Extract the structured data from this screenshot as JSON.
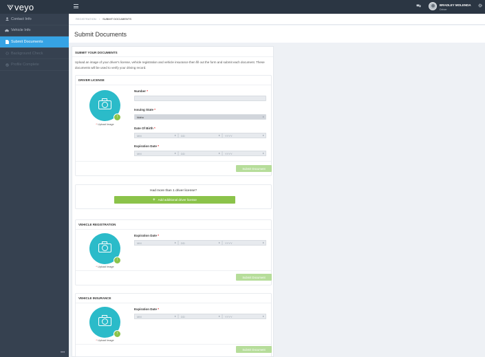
{
  "app": {
    "logo": "veyo"
  },
  "sidebar": {
    "items": [
      {
        "label": "Contact Info",
        "icon": "user-icon",
        "state": "normal"
      },
      {
        "label": "Vehicle Info",
        "icon": "car-icon",
        "state": "normal"
      },
      {
        "label": "Submit Documents",
        "icon": "document-icon",
        "state": "active"
      },
      {
        "label": "Background Check",
        "icon": "gear-icon",
        "state": "disabled"
      },
      {
        "label": "Profile Complete",
        "icon": "check-icon",
        "state": "disabled"
      }
    ]
  },
  "topbar": {
    "user_name": "BRADLEY MOLENDA",
    "user_role": "Driver"
  },
  "breadcrumb": {
    "root": "REGISTRATION",
    "current": "SUBMIT DOCUMENTS"
  },
  "page_title": "Submit Documents",
  "panel": {
    "heading": "SUBMIT YOUR DOCUMENTS",
    "intro": "Upload an image of your driver's license, vehicle registration and vehicle insurance then fill out the form and submit each document. These documents will be used to verify your driving record."
  },
  "upload_label": "Upload Image",
  "date_placeholders": {
    "mm": "MM",
    "dd": "DD",
    "yyyy": "YYYY"
  },
  "submit_label": "Submit Document",
  "driver_license": {
    "title": "DRIVER LICENSE",
    "number_label": "Number",
    "number_value": "",
    "state_label": "Issuing State",
    "state_value": "Idaho",
    "dob_label": "Date Of Birth",
    "exp_label": "Expiration Date"
  },
  "additional": {
    "text": "Had more than 1 driver license?",
    "button": "Add additional driver license"
  },
  "vehicle_registration": {
    "title": "VEHICLE REGISTRATION",
    "exp_label": "Expiration Date"
  },
  "vehicle_insurance": {
    "title": "VEHICLE INSURANCE",
    "exp_label": "Expiration Date"
  },
  "colors": {
    "accent": "#36a3e4",
    "sidebar": "#364150",
    "camera": "#2bbbc9",
    "green": "#8bc34a"
  }
}
